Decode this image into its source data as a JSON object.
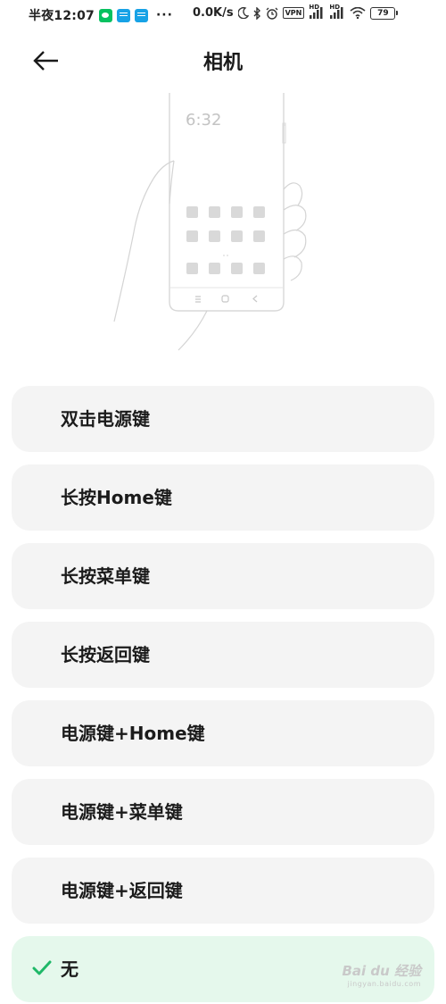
{
  "status": {
    "time": "半夜12:07",
    "speed": "0.0K/s",
    "vpn": "VPN",
    "hd1": "HD",
    "hd2": "HD",
    "battery": "79",
    "dots": "···"
  },
  "header": {
    "title": "相机"
  },
  "illustration": {
    "clock": "6:32"
  },
  "options": [
    {
      "label": "双击电源键",
      "selected": false
    },
    {
      "label": "长按Home键",
      "selected": false
    },
    {
      "label": "长按菜单键",
      "selected": false
    },
    {
      "label": "长按返回键",
      "selected": false
    },
    {
      "label": "电源键+Home键",
      "selected": false
    },
    {
      "label": "电源键+菜单键",
      "selected": false
    },
    {
      "label": "电源键+返回键",
      "selected": false
    },
    {
      "label": "无",
      "selected": true
    }
  ],
  "watermark": {
    "main": "Bai du 经验",
    "sub": "jingyan.baidu.com"
  },
  "colors": {
    "accent": "#1fb868",
    "selected_bg": "#e5f8ec",
    "option_bg": "#f4f4f4"
  }
}
